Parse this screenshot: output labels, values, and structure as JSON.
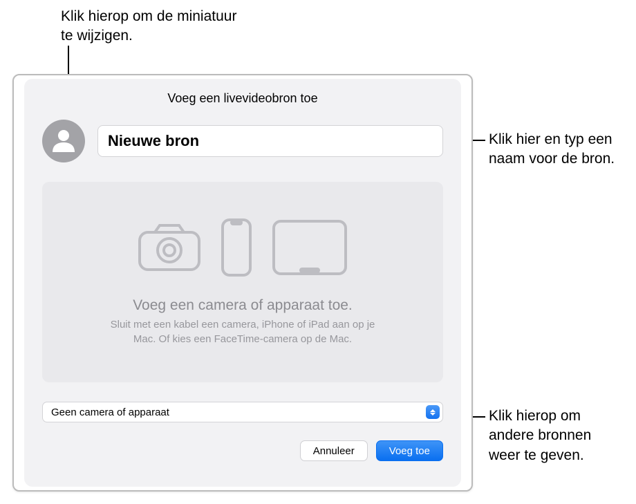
{
  "callouts": {
    "top": "Klik hierop om de miniatuur te wijzigen.",
    "name": "Klik hier en typ een naam voor de bron.",
    "select": "Klik hierop om andere bronnen weer te geven."
  },
  "dialog": {
    "title": "Voeg een livevideobron toe",
    "name_value": "Nieuwe bron",
    "preview": {
      "title": "Voeg een camera of apparaat toe.",
      "subtitle": "Sluit met een kabel een camera, iPhone of iPad aan op je Mac. Of kies een FaceTime-camera op de Mac."
    },
    "select": {
      "label": "Geen camera of apparaat"
    },
    "cancel_label": "Annuleer",
    "confirm_label": "Voeg toe"
  }
}
